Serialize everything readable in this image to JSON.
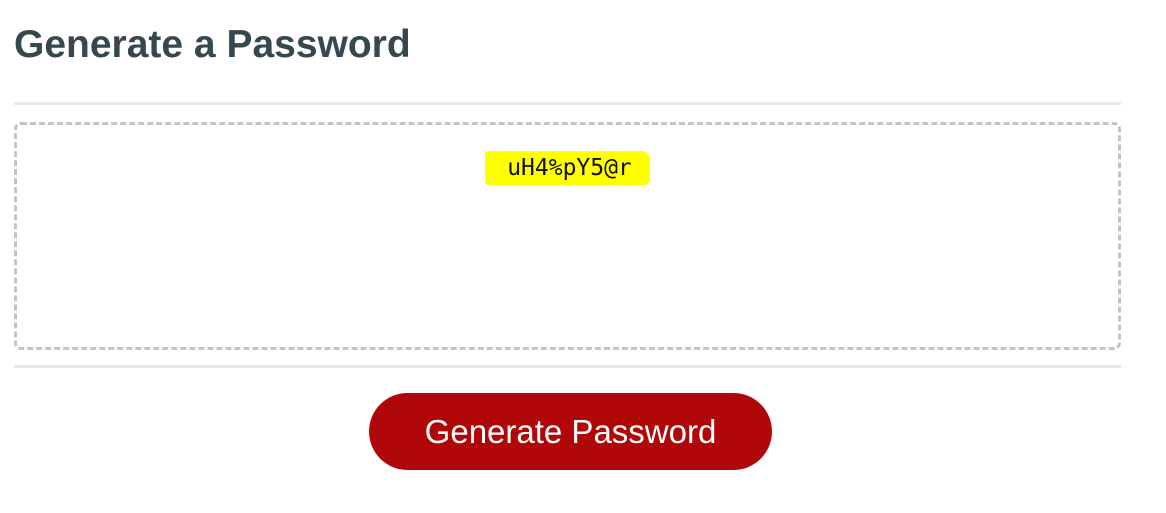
{
  "header": {
    "title": "Generate a Password"
  },
  "password": {
    "value": "uH4%pY5@r",
    "highlight_color": "#ffff00"
  },
  "actions": {
    "generate_label": "Generate Password",
    "button_color": "#b00808"
  },
  "colors": {
    "title": "#37474f",
    "divider": "#e6e8ea",
    "box_border": "#c0c5cd"
  }
}
